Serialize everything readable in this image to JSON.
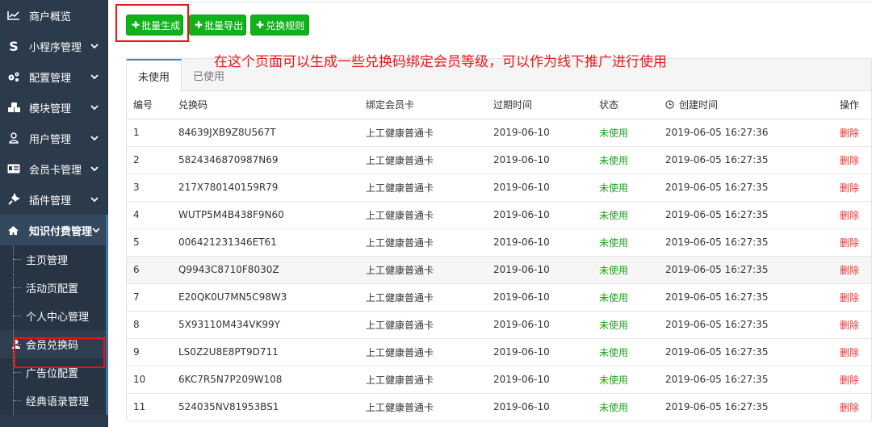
{
  "sidebar": {
    "items": [
      {
        "label": "商户概览",
        "icon": "chart-line-icon",
        "chevron": false
      },
      {
        "label": "小程序管理",
        "icon": "miniprogram-s-icon",
        "chevron": true
      },
      {
        "label": "配置管理",
        "icon": "gears-icon",
        "chevron": true
      },
      {
        "label": "模块管理",
        "icon": "cubes-icon",
        "chevron": true
      },
      {
        "label": "用户管理",
        "icon": "user-icon",
        "chevron": true
      },
      {
        "label": "会员卡管理",
        "icon": "id-card-icon",
        "chevron": true
      },
      {
        "label": "插件管理",
        "icon": "plug-icon",
        "chevron": true
      },
      {
        "label": "知识付费管理",
        "icon": "home-icon",
        "chevron": true
      }
    ],
    "subitems": [
      {
        "label": "主页管理"
      },
      {
        "label": "活动页配置"
      },
      {
        "label": "个人中心管理"
      },
      {
        "label": "会员兑换码"
      },
      {
        "label": "广告位配置"
      },
      {
        "label": "经典语录管理"
      }
    ]
  },
  "toolbar": {
    "generate_label": "批量生成",
    "export_label": "批量导出",
    "rules_label": "兑换规则"
  },
  "annotation": "在这个页面可以生成一些兑换码绑定会员等级，可以作为线下推广进行使用",
  "tabs": [
    "未使用",
    "已使用"
  ],
  "table": {
    "headers": [
      "编号",
      "兑换码",
      "绑定会员卡",
      "过期时间",
      "状态",
      "创建时间",
      "操作"
    ],
    "rows": [
      {
        "id": "1",
        "code": "84639JXB9Z8U567T",
        "card": "上工健康普通卡",
        "expire": "2019-06-10",
        "status": "未使用",
        "created": "2019-06-05 16:27:36",
        "action": "删除"
      },
      {
        "id": "2",
        "code": "5824346870987N69",
        "card": "上工健康普通卡",
        "expire": "2019-06-10",
        "status": "未使用",
        "created": "2019-06-05 16:27:35",
        "action": "删除"
      },
      {
        "id": "3",
        "code": "217X780140159R79",
        "card": "上工健康普通卡",
        "expire": "2019-06-10",
        "status": "未使用",
        "created": "2019-06-05 16:27:35",
        "action": "删除"
      },
      {
        "id": "4",
        "code": "WUTP5M4B438F9N60",
        "card": "上工健康普通卡",
        "expire": "2019-06-10",
        "status": "未使用",
        "created": "2019-06-05 16:27:35",
        "action": "删除"
      },
      {
        "id": "5",
        "code": "006421231346ET61",
        "card": "上工健康普通卡",
        "expire": "2019-06-10",
        "status": "未使用",
        "created": "2019-06-05 16:27:35",
        "action": "删除"
      },
      {
        "id": "6",
        "code": "Q9943C8710F8030Z",
        "card": "上工健康普通卡",
        "expire": "2019-06-10",
        "status": "未使用",
        "created": "2019-06-05 16:27:35",
        "action": "删除"
      },
      {
        "id": "7",
        "code": "E20QK0U7MN5C98W3",
        "card": "上工健康普通卡",
        "expire": "2019-06-10",
        "status": "未使用",
        "created": "2019-06-05 16:27:35",
        "action": "删除"
      },
      {
        "id": "8",
        "code": "5X93110M434VK99Y",
        "card": "上工健康普通卡",
        "expire": "2019-06-10",
        "status": "未使用",
        "created": "2019-06-05 16:27:35",
        "action": "删除"
      },
      {
        "id": "9",
        "code": "LS0Z2U8E8PT9D711",
        "card": "上工健康普通卡",
        "expire": "2019-06-10",
        "status": "未使用",
        "created": "2019-06-05 16:27:35",
        "action": "删除"
      },
      {
        "id": "10",
        "code": "6KC7R5N7P209W108",
        "card": "上工健康普通卡",
        "expire": "2019-06-10",
        "status": "未使用",
        "created": "2019-06-05 16:27:35",
        "action": "删除"
      },
      {
        "id": "11",
        "code": "524035NV81953BS1",
        "card": "上工健康普通卡",
        "expire": "2019-06-10",
        "status": "未使用",
        "created": "2019-06-05 16:27:35",
        "action": "删除"
      }
    ]
  },
  "colors": {
    "sidebar_bg": "#2c3b4c",
    "button_green": "#10b21a",
    "status_green": "#1aa31a",
    "delete_red": "#e33333",
    "highlight_red": "#e11111"
  }
}
